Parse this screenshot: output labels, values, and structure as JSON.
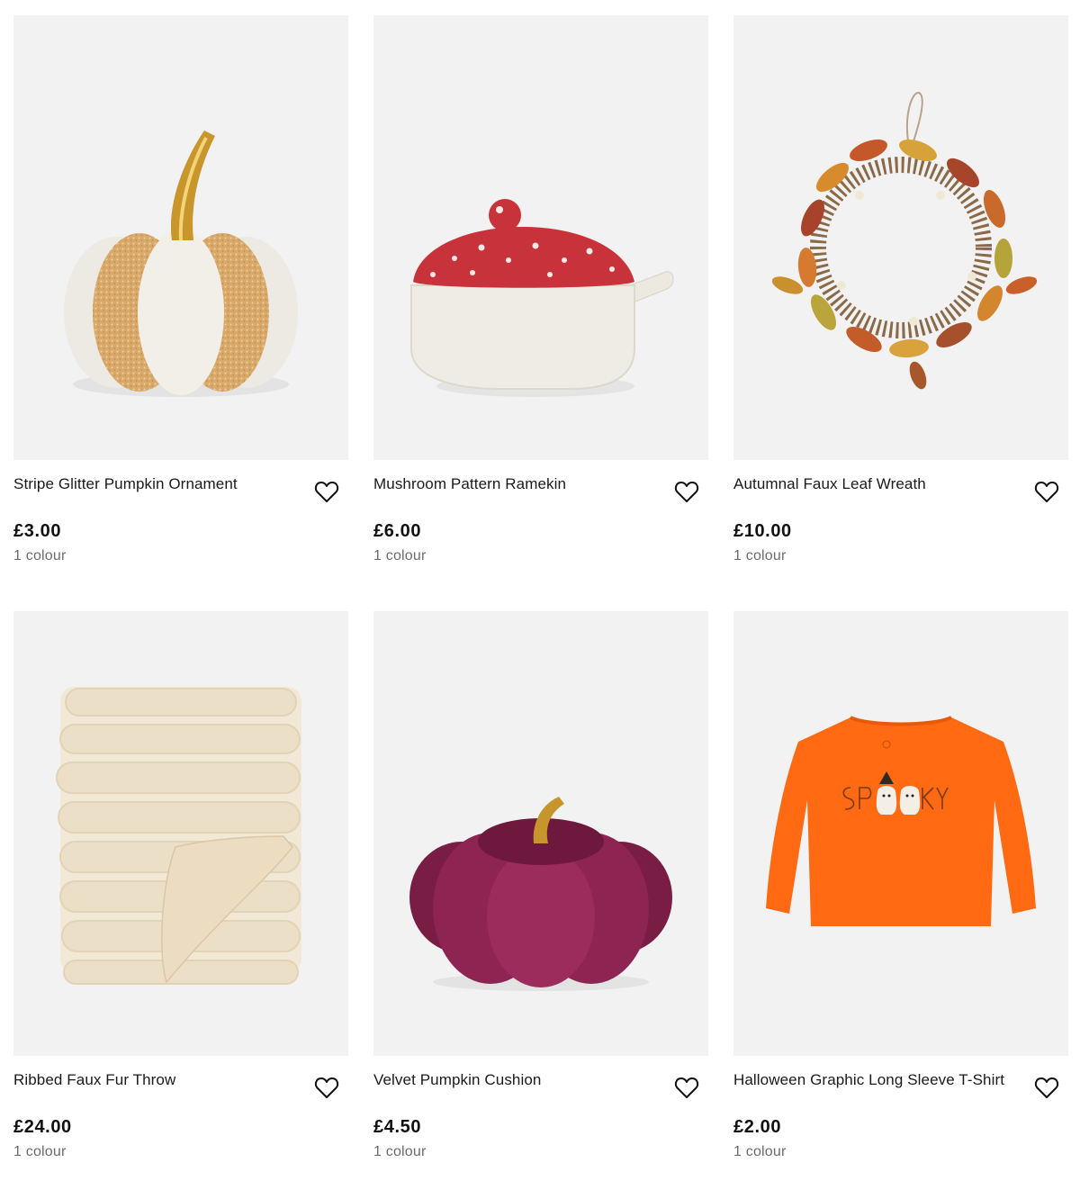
{
  "products": [
    {
      "name": "Stripe Glitter Pumpkin Ornament",
      "price": "£3.00",
      "colours": "1 colour",
      "image": "glitter-pumpkin-image"
    },
    {
      "name": "Mushroom Pattern Ramekin",
      "price": "£6.00",
      "colours": "1 colour",
      "image": "mushroom-ramekin-image"
    },
    {
      "name": "Autumnal Faux Leaf Wreath",
      "price": "£10.00",
      "colours": "1 colour",
      "image": "leaf-wreath-image"
    },
    {
      "name": "Ribbed Faux Fur Throw",
      "price": "£24.00",
      "colours": "1 colour",
      "image": "fur-throw-image"
    },
    {
      "name": "Velvet Pumpkin Cushion",
      "price": "£4.50",
      "colours": "1 colour",
      "image": "velvet-pumpkin-image"
    },
    {
      "name": "Halloween Graphic Long Sleeve T-Shirt",
      "price": "£2.00",
      "colours": "1 colour",
      "image": "halloween-tshirt-image"
    }
  ],
  "wishlist_icon": "heart-icon",
  "colors": {
    "image_background": "#f2f2f2",
    "text": "#1a1a1a",
    "muted_text": "#6b6b6b"
  }
}
